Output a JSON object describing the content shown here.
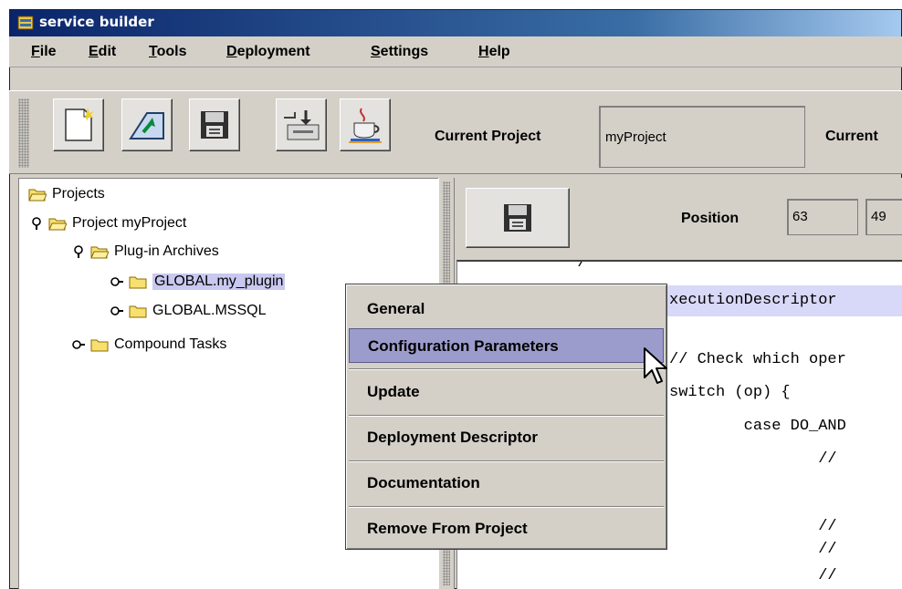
{
  "window": {
    "title": "service builder"
  },
  "menubar": {
    "items": [
      {
        "first": "F",
        "rest": "ile"
      },
      {
        "first": "E",
        "rest": "dit"
      },
      {
        "first": "T",
        "rest": "ools"
      },
      {
        "first": "D",
        "rest": "eployment"
      },
      {
        "first": "S",
        "rest": "ettings"
      },
      {
        "first": "H",
        "rest": "elp"
      }
    ]
  },
  "toolbar": {
    "current_project_label": "Current Project",
    "current_project_value": "myProject",
    "current_label_2": "Current"
  },
  "tree": {
    "projects": "Projects",
    "project": "Project myProject",
    "plugin_archives": "Plug-in Archives",
    "global_my_plugin": "GLOBAL.my_plugin",
    "global_mssql": "GLOBAL.MSSQL",
    "compound_tasks": "Compound Tasks"
  },
  "editor": {
    "position_label": "Position",
    "position_line": "63",
    "position_col": "49",
    "code_lines": {
      "l1": "      */",
      "l2": "xecutionDescriptor",
      "l3": "// Check which oper",
      "l4": "switch (op) {",
      "l5": "        case DO_AND",
      "l6": "                //",
      "l7": "                //",
      "l8": "                //",
      "l9": "                //"
    }
  },
  "context_menu": {
    "general": "General",
    "configuration_parameters": "Configuration Parameters",
    "update": "Update",
    "deployment_descriptor": "Deployment Descriptor",
    "documentation": "Documentation",
    "remove_from_project": "Remove From Project"
  }
}
